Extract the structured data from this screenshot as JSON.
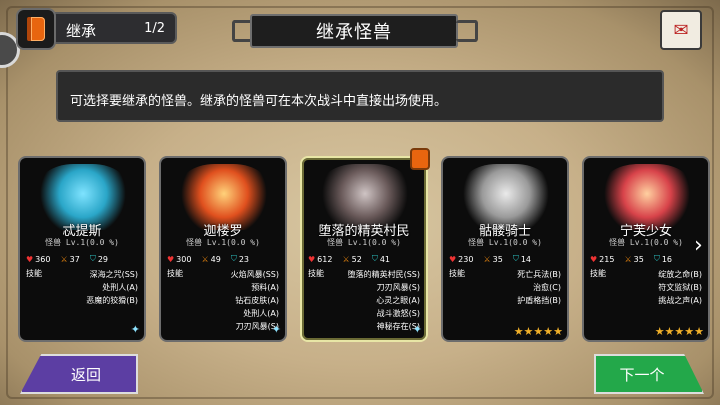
{
  "header": {
    "tab_label": "继承",
    "page_count": "1/2",
    "title": "继承怪兽"
  },
  "info_text": "可选择要继承的怪兽。继承的怪兽可在本次战斗中直接出场使用。",
  "cards": [
    {
      "name": "忒提斯",
      "sub": "怪兽 Lv.1(0.0 %)",
      "hp": "360",
      "atk": "37",
      "def": "29",
      "skills_label": "技能",
      "skills": [
        "深海之咒(SS)",
        "处刑人(A)",
        "恶魔的狡猾(B)"
      ],
      "stars": "",
      "art_color": "#2aa6c8"
    },
    {
      "name": "迦楼罗",
      "sub": "怪兽 Lv.1(0.0 %)",
      "hp": "300",
      "atk": "49",
      "def": "23",
      "skills_label": "技能",
      "skills": [
        "火焰风暴(SS)",
        "预料(A)",
        "钻石皮肤(A)",
        "处刑人(A)",
        "刀刃风暴(S)"
      ],
      "stars": "",
      "art_color": "#e0501e"
    },
    {
      "name": "堕落的精英村民",
      "sub": "怪兽 Lv.1(0.0 %)",
      "hp": "612",
      "atk": "52",
      "def": "41",
      "skills_label": "技能",
      "skills": [
        "堕落的精英村民(SS)",
        "刀刃风暴(S)",
        "心灵之眼(A)",
        "战斗激怒(S)",
        "神秘存在(S)"
      ],
      "stars": "",
      "art_color": "#6a5a5a"
    },
    {
      "name": "骷髅骑士",
      "sub": "怪兽 Lv.1(0.0 %)",
      "hp": "230",
      "atk": "35",
      "def": "14",
      "skills_label": "技能",
      "skills": [
        "死亡兵法(B)",
        "治愈(C)",
        "护盾格挡(B)"
      ],
      "stars": "★★★★★",
      "art_color": "#9a9a9a"
    },
    {
      "name": "宁芙少女",
      "sub": "怪兽 Lv.1(0.0 %)",
      "hp": "215",
      "atk": "35",
      "def": "16",
      "skills_label": "技能",
      "skills": [
        "绽放之命(B)",
        "符文监狱(B)",
        "挑战之声(A)"
      ],
      "stars": "★★★★★",
      "art_color": "#d8434a"
    }
  ],
  "buttons": {
    "back": "返回",
    "next": "下一个"
  }
}
